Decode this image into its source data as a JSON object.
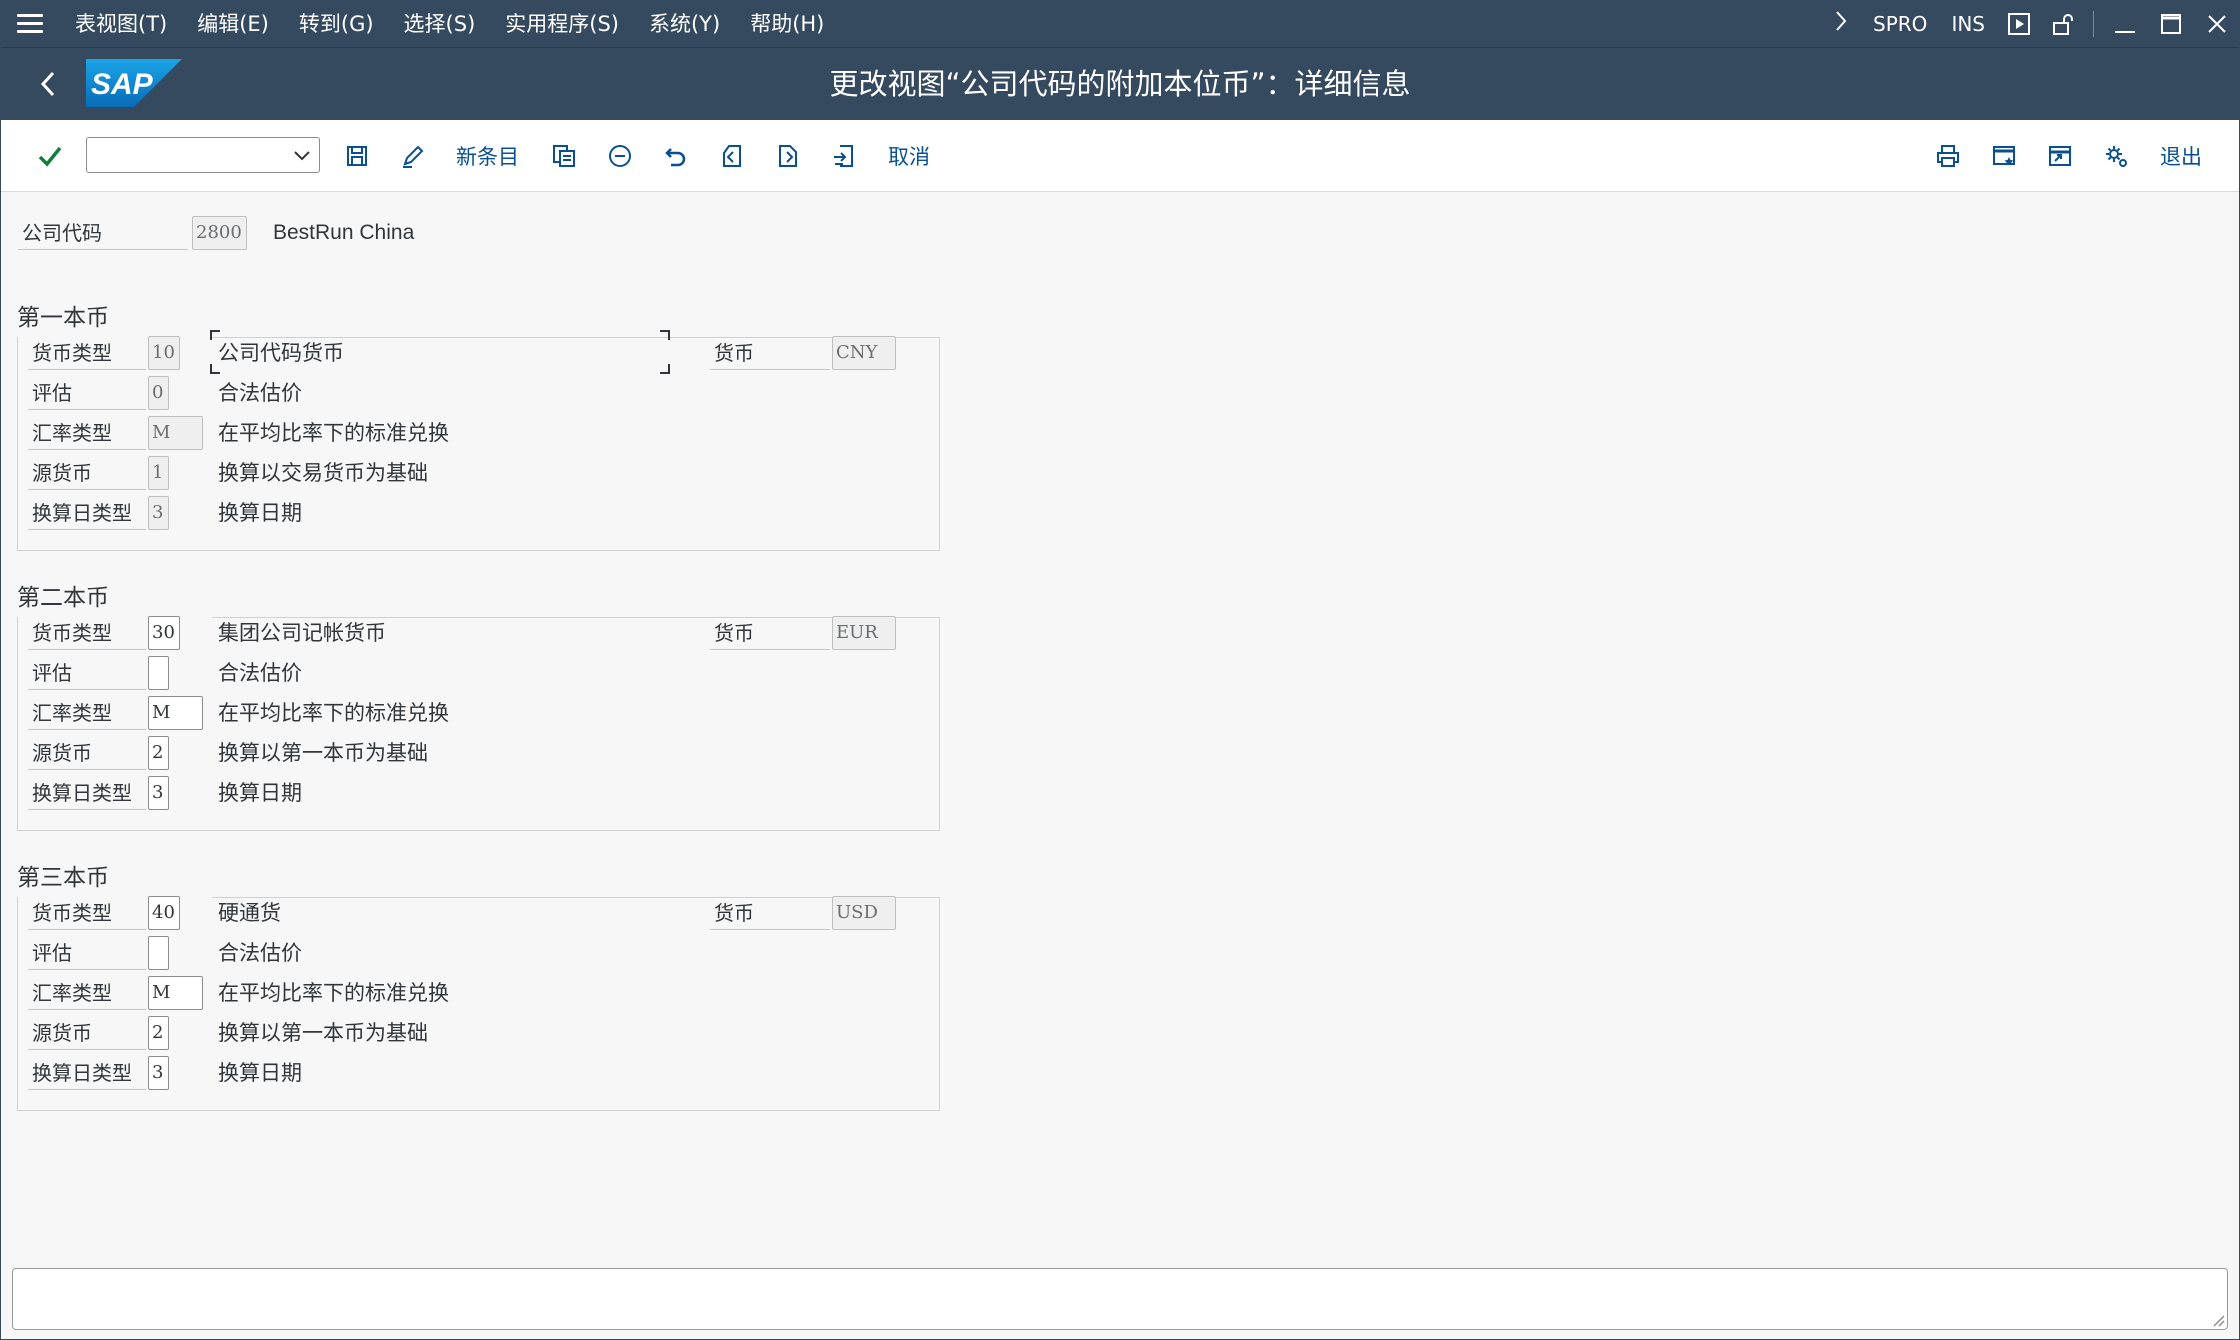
{
  "menubar": {
    "items": [
      "表视图(T)",
      "编辑(E)",
      "转到(G)",
      "选择(S)",
      "实用程序(S)",
      "系统(Y)",
      "帮助(H)"
    ],
    "transaction": "SPRO",
    "mode": "INS"
  },
  "titlebar": {
    "title": "更改视图“公司代码的附加本位币”：详细信息",
    "logo_text": "SAP"
  },
  "toolbar": {
    "command_value": "",
    "new_entries_label": "新条目",
    "cancel_label": "取消",
    "exit_label": "退出"
  },
  "header": {
    "company_code_label": "公司代码",
    "company_code_value": "2800",
    "company_name": "BestRun China"
  },
  "groups": [
    {
      "title": "第一本币",
      "currency_label": "货币",
      "currency_value": "CNY",
      "rows": [
        {
          "label": "货币类型",
          "value": "10",
          "text": "公司代码货币"
        },
        {
          "label": "评估",
          "value": "0",
          "text": "合法估价"
        },
        {
          "label": "汇率类型",
          "value": "M",
          "text": "在平均比率下的标准兑换"
        },
        {
          "label": "源货币",
          "value": "1",
          "text": "换算以交易货币为基础"
        },
        {
          "label": "换算日类型",
          "value": "3",
          "text": "换算日期"
        }
      ]
    },
    {
      "title": "第二本币",
      "currency_label": "货币",
      "currency_value": "EUR",
      "rows": [
        {
          "label": "货币类型",
          "value": "30",
          "text": "集团公司记帐货币"
        },
        {
          "label": "评估",
          "value": "",
          "text": "合法估价"
        },
        {
          "label": "汇率类型",
          "value": "M",
          "text": "在平均比率下的标准兑换"
        },
        {
          "label": "源货币",
          "value": "2",
          "text": "换算以第一本币为基础"
        },
        {
          "label": "换算日类型",
          "value": "3",
          "text": "换算日期"
        }
      ]
    },
    {
      "title": "第三本币",
      "currency_label": "货币",
      "currency_value": "USD",
      "rows": [
        {
          "label": "货币类型",
          "value": "40",
          "text": "硬通货"
        },
        {
          "label": "评估",
          "value": "",
          "text": "合法估价"
        },
        {
          "label": "汇率类型",
          "value": "M",
          "text": "在平均比率下的标准兑换"
        },
        {
          "label": "源货币",
          "value": "2",
          "text": "换算以第一本币为基础"
        },
        {
          "label": "换算日类型",
          "value": "3",
          "text": "换算日期"
        }
      ]
    }
  ],
  "statusbar": {
    "message": ""
  },
  "colors": {
    "shell": "#354a5f",
    "link": "#0a4f8f",
    "check": "#107e3e",
    "background": "#f7f7f7"
  },
  "icons": [
    "hamburger-icon",
    "chevron-right-icon",
    "play-icon",
    "lock-icon",
    "minimize-icon",
    "maximize-icon",
    "close-icon",
    "back-icon",
    "check-icon",
    "save-icon",
    "edit-icon",
    "copy-icon",
    "delete-icon",
    "undo-icon",
    "previous-entry-icon",
    "next-entry-icon",
    "other-entry-icon",
    "print-icon",
    "favorite-window-icon",
    "new-window-icon",
    "settings-icon"
  ]
}
